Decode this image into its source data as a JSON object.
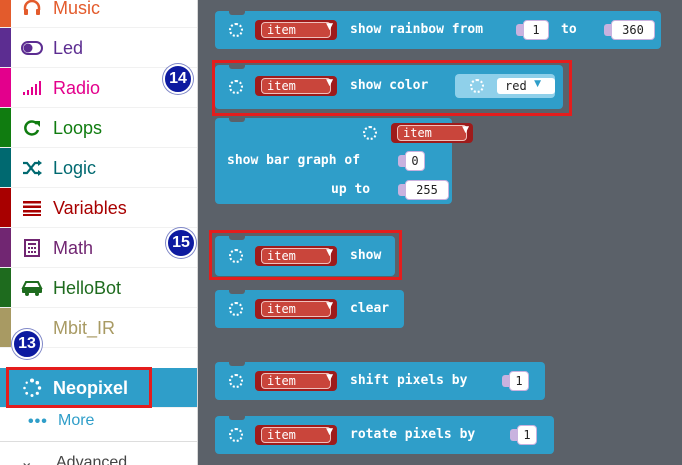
{
  "sidebar": {
    "categories": [
      {
        "id": "music",
        "label": "Music",
        "icon": "headphones-icon",
        "color": "#e35b2c"
      },
      {
        "id": "led",
        "label": "Led",
        "icon": "toggle-icon",
        "color": "#5c2d91"
      },
      {
        "id": "radio",
        "label": "Radio",
        "icon": "signal-bars-icon",
        "color": "#e3008c"
      },
      {
        "id": "loops",
        "label": "Loops",
        "icon": "refresh-icon",
        "color": "#107c10"
      },
      {
        "id": "logic",
        "label": "Logic",
        "icon": "shuffle-icon",
        "color": "#006970"
      },
      {
        "id": "variables",
        "label": "Variables",
        "icon": "list-icon",
        "color": "#a80000"
      },
      {
        "id": "math",
        "label": "Math",
        "icon": "calculator-icon",
        "color": "#712672"
      },
      {
        "id": "hellobot",
        "label": "HelloBot",
        "icon": "car-icon",
        "color": "#1e6b1e"
      },
      {
        "id": "mbit_ir",
        "label": "Mbit_IR",
        "icon": "none",
        "color": "#a89a63"
      },
      {
        "id": "neopixel",
        "label": "Neopixel",
        "icon": "spinner-icon",
        "color": "#2f9ec9"
      }
    ],
    "more": {
      "label": "More",
      "icon": "dots-icon"
    },
    "advanced": {
      "label": "Advanced",
      "icon": "chevron-down-icon"
    }
  },
  "blocks": {
    "item_label": "item",
    "show_rainbow": {
      "text1": "show rainbow from",
      "from": "1",
      "text2": "to",
      "to": "360"
    },
    "show_color": {
      "text": "show color",
      "color": "red"
    },
    "show_bar_graph": {
      "line1": "show bar graph of",
      "value": "0",
      "line2": "up to",
      "up_to": "255"
    },
    "show": {
      "text": "show"
    },
    "clear": {
      "text": "clear"
    },
    "shift_pixels": {
      "text": "shift pixels by",
      "value": "1"
    },
    "rotate_pixels": {
      "text": "rotate pixels by",
      "value": "1"
    }
  },
  "annotations": {
    "badge_13": "13",
    "badge_14": "14",
    "badge_15": "15",
    "highlight_color": "#e41d1d",
    "badge_color": "#0d1aa0"
  }
}
